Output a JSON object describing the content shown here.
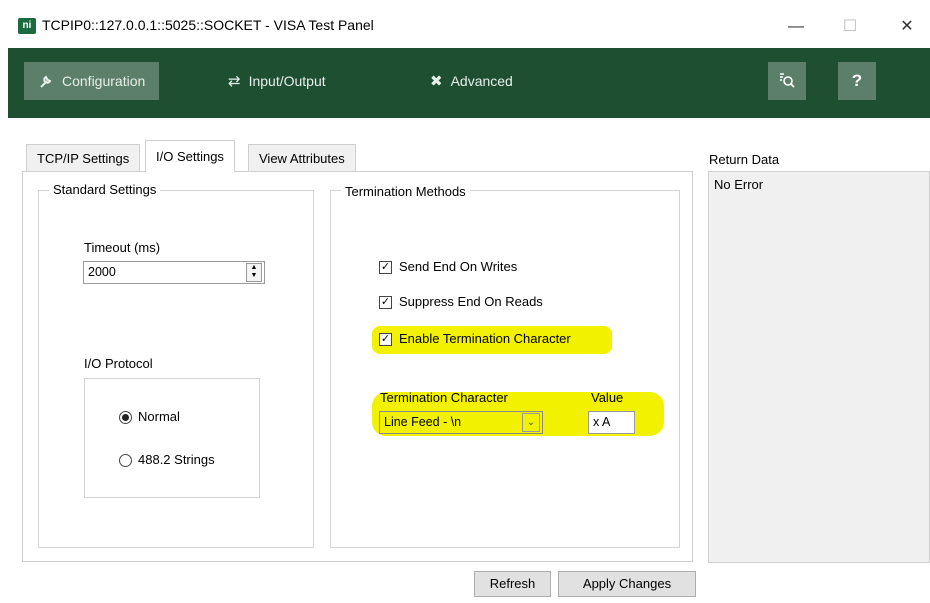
{
  "window": {
    "logo_text": "ni",
    "title": "TCPIP0::127.0.0.1::5025::SOCKET - VISA Test Panel",
    "controls": {
      "minimize": "—",
      "maximize": "☐",
      "close": "✕"
    }
  },
  "toolbar": {
    "items": [
      {
        "label": "Configuration",
        "icon": "wrench-icon",
        "active": true
      },
      {
        "label": "Input/Output",
        "icon": "swap-arrows-icon",
        "active": false
      },
      {
        "label": "Advanced",
        "icon": "tools-icon",
        "active": false
      }
    ],
    "right_buttons": [
      {
        "icon": "search-inspect-icon"
      },
      {
        "label": "?",
        "icon": "help-icon"
      }
    ]
  },
  "tabs": [
    {
      "label": "TCP/IP Settings",
      "active": false
    },
    {
      "label": "I/O Settings",
      "active": true
    },
    {
      "label": "View Attributes",
      "active": false
    }
  ],
  "standard_settings": {
    "title": "Standard Settings",
    "timeout_label": "Timeout (ms)",
    "timeout_value": "2000",
    "io_protocol_label": "I/O Protocol",
    "protocols": [
      {
        "label": "Normal",
        "selected": true
      },
      {
        "label": "488.2 Strings",
        "selected": false
      }
    ]
  },
  "termination": {
    "title": "Termination Methods",
    "checkboxes": [
      {
        "label": "Send End On Writes",
        "checked": true
      },
      {
        "label": "Suppress End On Reads",
        "checked": true
      },
      {
        "label": "Enable Termination Character",
        "checked": true,
        "highlighted": true
      }
    ],
    "char_label": "Termination Character",
    "char_value": "Line Feed - \\n",
    "value_label": "Value",
    "value": "x A"
  },
  "return_data": {
    "label": "Return Data",
    "text": "No Error"
  },
  "buttons": {
    "refresh": "Refresh",
    "apply": "Apply Changes"
  },
  "colors": {
    "toolbar_bg": "#1f4f31",
    "toolbar_active": "#5c7f69",
    "highlight": "#f2f200"
  }
}
